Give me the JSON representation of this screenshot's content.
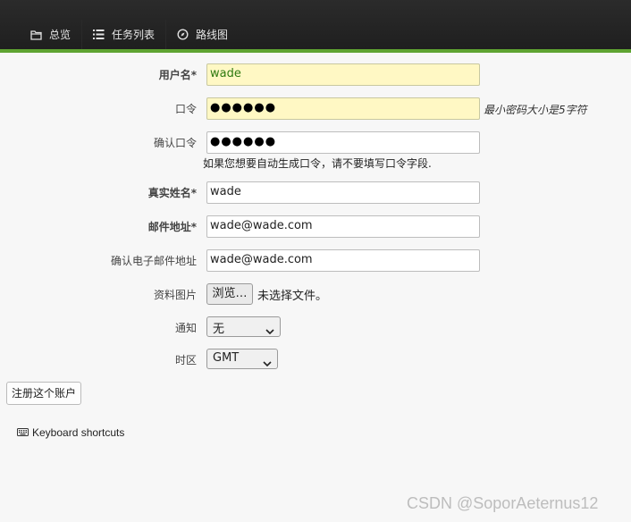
{
  "nav": {
    "items": [
      {
        "label": "总览",
        "icon": "folder-icon"
      },
      {
        "label": "任务列表",
        "icon": "list-icon"
      },
      {
        "label": "路线图",
        "icon": "compass-icon"
      }
    ]
  },
  "form": {
    "username": {
      "label": "用户名*",
      "value": "wade"
    },
    "password": {
      "label": "口令",
      "value": "●●●●●●",
      "hint": "最小密码大小是5字符"
    },
    "confirm_password": {
      "label": "确认口令",
      "value": "●●●●●●",
      "help": "如果您想要自动生成口令，请不要填写口令字段."
    },
    "real_name": {
      "label": "真实姓名*",
      "value": "wade"
    },
    "email": {
      "label": "邮件地址*",
      "value": "wade@wade.com"
    },
    "confirm_email": {
      "label": "确认电子邮件地址",
      "value": "wade@wade.com"
    },
    "avatar": {
      "label": "资料图片",
      "button_label": "浏览…",
      "status": "未选择文件。"
    },
    "notify": {
      "label": "通知",
      "selected": "无"
    },
    "timezone": {
      "label": "时区",
      "selected": "GMT"
    },
    "submit_label": "注册这个账户"
  },
  "footer": {
    "keyboard_shortcuts": "Keyboard shortcuts",
    "watermark": "CSDN @SoporAeternus12"
  },
  "colors": {
    "accent_green": "#5fa432",
    "topbar": "#222222",
    "autofill_yellow": "#fff8c4"
  }
}
